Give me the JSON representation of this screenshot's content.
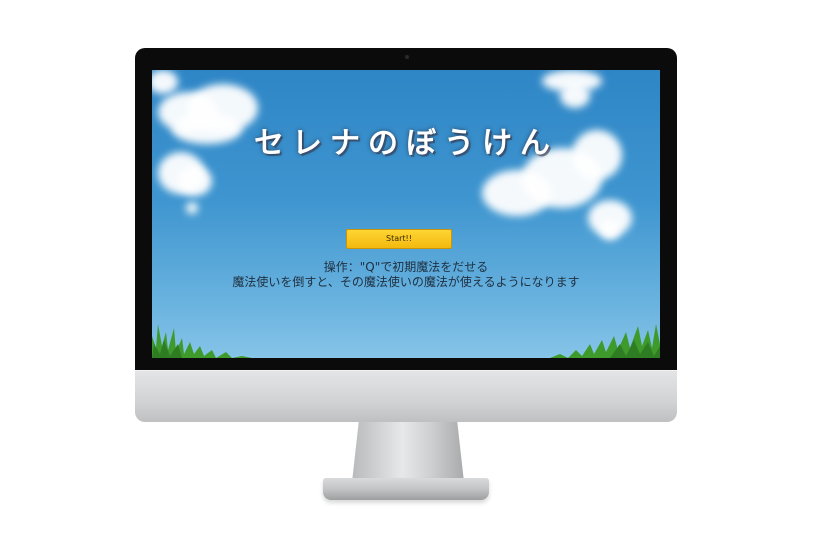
{
  "game": {
    "title": "セレナのぼうけん",
    "start_button_label": "Start!!",
    "controls_line": "操作：\"Q\"で初期魔法をだせる",
    "description_line": "魔法使いを倒すと、その魔法使いの魔法が使えるようになります"
  },
  "colors": {
    "sky_top": "#2f86c6",
    "sky_bottom": "#86c4e8",
    "button": "#f2b90e",
    "grass": "#3f9a2c"
  }
}
